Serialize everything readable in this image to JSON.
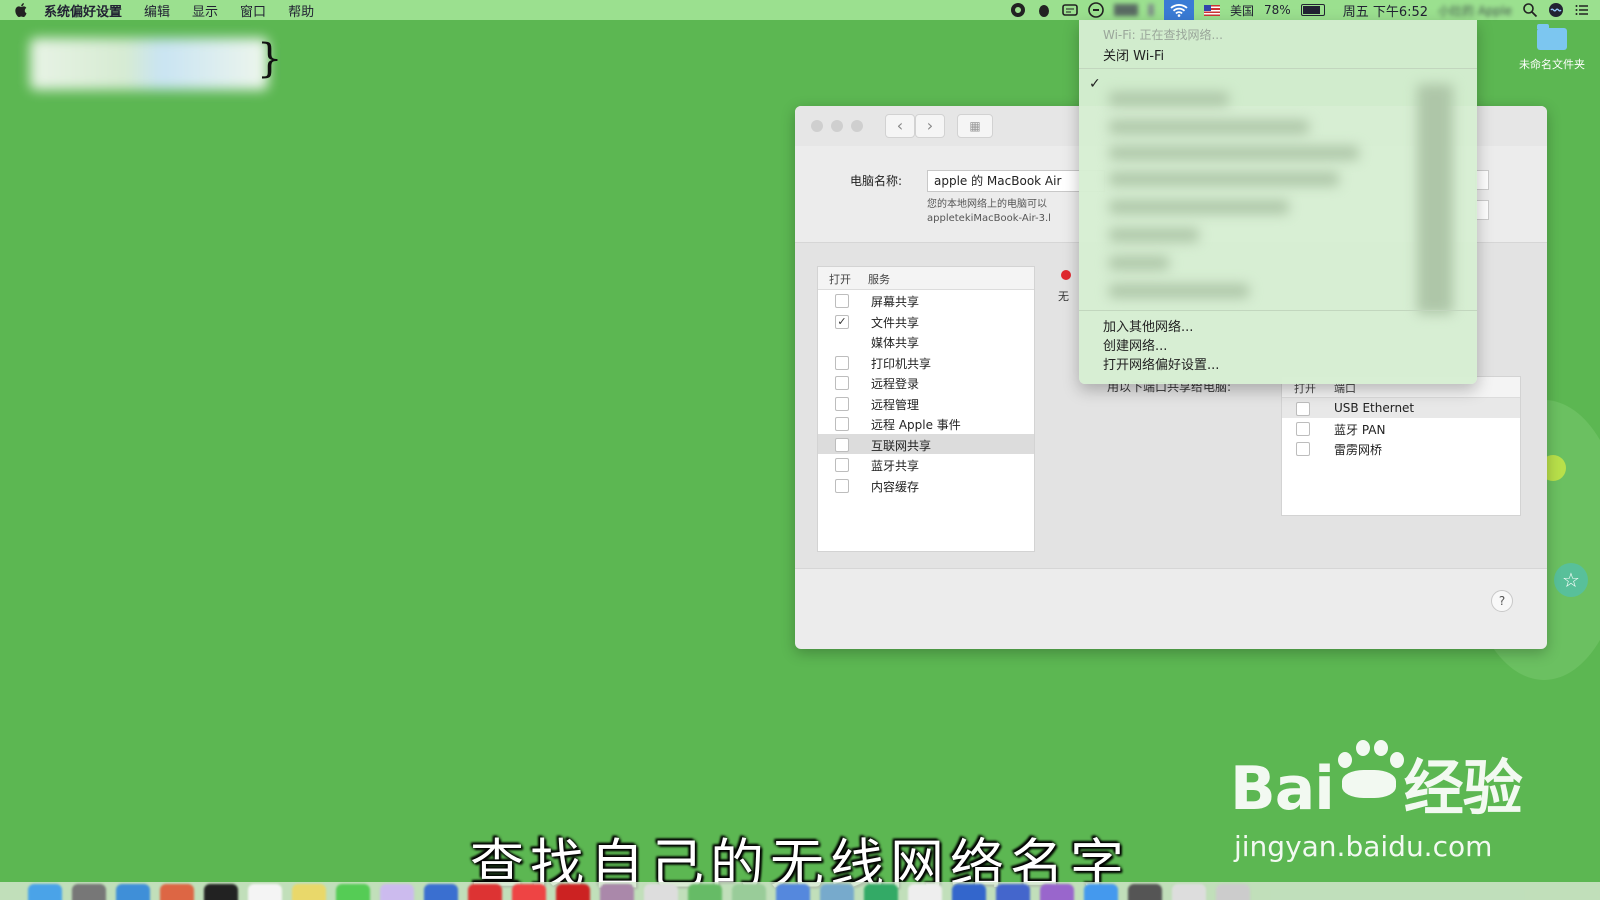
{
  "menubar": {
    "app_name": "系统偏好设置",
    "menus": [
      "编辑",
      "显示",
      "窗口",
      "帮助"
    ],
    "status": {
      "input_source": "美国",
      "battery_percent": "78%",
      "battery_level": 0.78,
      "clock": "周五 下午6:52",
      "user": "小灶的 Apple"
    }
  },
  "desktop": {
    "folder_label": "未命名文件夹"
  },
  "window": {
    "computer_name_label": "电脑名称:",
    "computer_name_value": "apple 的 MacBook Air",
    "computer_name_desc_1": "您的本地网络上的电脑可以",
    "computer_name_desc_2": "appletekiMacBook-Air-3.l",
    "services_table": {
      "col_on": "打开",
      "col_service": "服务",
      "rows": [
        {
          "label": "屏幕共享",
          "checked": false
        },
        {
          "label": "文件共享",
          "checked": true
        },
        {
          "label": "媒体共享",
          "checked": false
        },
        {
          "label": "打印机共享",
          "checked": false
        },
        {
          "label": "远程登录",
          "checked": false
        },
        {
          "label": "远程管理",
          "checked": false
        },
        {
          "label": "远程 Apple 事件",
          "checked": false
        },
        {
          "label": "互联网共享",
          "checked": false,
          "selected": true
        },
        {
          "label": "蓝牙共享",
          "checked": false
        },
        {
          "label": "内容缓存",
          "checked": false
        }
      ]
    },
    "status_fragment": "无",
    "share_to_label": "用以下端口共享给电脑:",
    "ports_table": {
      "col_on": "打开",
      "col_port": "端口",
      "rows": [
        {
          "label": "USB Ethernet"
        },
        {
          "label": "蓝牙 PAN"
        },
        {
          "label": "雷雳网桥"
        }
      ]
    },
    "help_label": "?"
  },
  "wifi_menu": {
    "status": "Wi-Fi: 正在查找网络...",
    "turn_off": "关闭 Wi-Fi",
    "checkmark": "✓",
    "actions": [
      "加入其他网络...",
      "创建网络...",
      "打开网络偏好设置..."
    ]
  },
  "subtitle": "查找自己的无线网络名字",
  "watermark": {
    "brand_latin": "Bai",
    "brand_cn": "经验",
    "url": "jingyan.baidu.com"
  },
  "colors": {
    "desktop_bg": "#5cb752",
    "accent": "#3a7bd5",
    "status_red": "#e0282e"
  }
}
